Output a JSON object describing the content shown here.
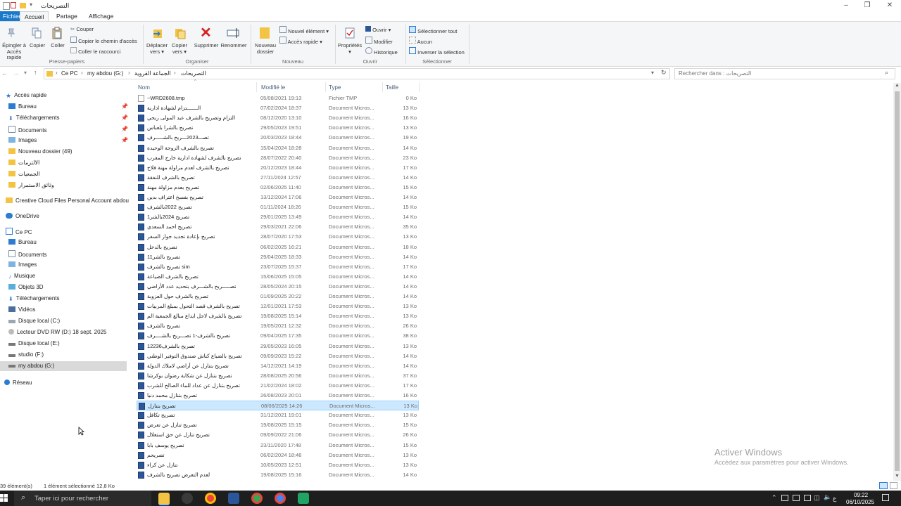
{
  "window": {
    "title": "التصريحات",
    "controls": [
      "–",
      "❐",
      "✕"
    ]
  },
  "ribbon_tabs": [
    "Fichier",
    "Accueil",
    "Partage",
    "Affichage"
  ],
  "ribbon": {
    "pin_label_1": "Épingler à",
    "pin_label_2": "Accès rapide",
    "copy": "Copier",
    "paste": "Coller",
    "cut": "Couper",
    "copy_path": "Copier le chemin d'accès",
    "paste_shortcut": "Coller le raccourci",
    "group_clipboard": "Presse-papiers",
    "move_to_1": "Déplacer",
    "move_to_2": "vers ▾",
    "copy_to_1": "Copier",
    "copy_to_2": "vers ▾",
    "delete": "Supprimer",
    "rename": "Renommer",
    "group_organize": "Organiser",
    "new_folder_1": "Nouveau",
    "new_folder_2": "dossier",
    "new_item": "Nouvel élément ▾",
    "easy_access": "Accès rapide ▾",
    "group_new": "Nouveau",
    "properties": "Propriétés",
    "open": "Ouvrir ▾",
    "edit": "Modifier",
    "history": "Historique",
    "group_open": "Ouvrir",
    "select_all": "Sélectionner tout",
    "select_none": "Aucun",
    "invert_selection": "Inverser la sélection",
    "group_select": "Sélectionner"
  },
  "breadcrumb": [
    "Ce PC",
    "my abdou (G:)",
    "الجماعة القروية",
    "التصريحات"
  ],
  "search": {
    "placeholder": "Rechercher dans : التصريحات"
  },
  "nav_pane": {
    "quick_access": "Accès rapide",
    "quick_items": [
      "Bureau",
      "Téléchargements",
      "Documents",
      "Images",
      "Nouveau dossier (49)",
      "الالتزمات",
      "الجمعيات",
      "وثائق الاستمرار"
    ],
    "creative_cloud": "Creative Cloud Files Personal Account abdou",
    "onedrive": "OneDrive",
    "this_pc": "Ce PC",
    "pc_items": [
      "Bureau",
      "Documents",
      "Images",
      "Musique",
      "Objets 3D",
      "Téléchargements",
      "Vidéos",
      "Disque local (C:)",
      "Lecteur DVD RW (D:) 18 sept. 2025",
      "Disque local (E:)",
      "studio (F:)",
      "my abdou (G:)"
    ],
    "network": "Réseau"
  },
  "columns": [
    "Nom",
    "Modifié le",
    "Type",
    "Taille"
  ],
  "files": [
    {
      "name": "~WRD2608.tmp",
      "date": "05/08/2021 19:13",
      "type": "Fichier TMP",
      "size": "0 Ko"
    },
    {
      "name": "الـــــــتزام لشهادة ادارية",
      "date": "07/02/2024 18:37",
      "type": "Document Micros...",
      "size": "13 Ko"
    },
    {
      "name": "التزام وتصريح بالشرف عبد المولى ربحي",
      "date": "08/12/2020 13:10",
      "type": "Document Micros...",
      "size": "16 Ko"
    },
    {
      "name": "تصريح بالشرا بلعباس",
      "date": "29/05/2023 19:51",
      "type": "Document Micros...",
      "size": "13 Ko"
    },
    {
      "name": "تصـــ2023ـــريح بالشـــــرف",
      "date": "20/03/2023 18:44",
      "type": "Document Micros...",
      "size": "19 Ko"
    },
    {
      "name": "تصريح بالشرف الزوجة الوحيدة",
      "date": "15/04/2024 18:28",
      "type": "Document Micros...",
      "size": "14 Ko"
    },
    {
      "name": "تصريح بالشرف لشهادة ادارية خارج المغرب",
      "date": "28/07/2022 20:40",
      "type": "Document Micros...",
      "size": "23 Ko"
    },
    {
      "name": "تصريح بالشرف لعدم مزاولة مهنة فلاح",
      "date": "20/12/2023 18:44",
      "type": "Document Micros...",
      "size": "17 Ko"
    },
    {
      "name": "تصريح بالشرف للنفقة",
      "date": "27/11/2024 12:57",
      "type": "Document Micros...",
      "size": "14 Ko"
    },
    {
      "name": "تصريح بعدم مزاولة مهنة",
      "date": "02/06/2025 11:40",
      "type": "Document Micros...",
      "size": "15 Ko"
    },
    {
      "name": "تصريح بفسخ اعتراف بدين",
      "date": "13/12/2024 17:06",
      "type": "Document Micros...",
      "size": "14 Ko"
    },
    {
      "name": "تصريح 2022بالشرف",
      "date": "01/11/2024 18:26",
      "type": "Document Micros...",
      "size": "15 Ko"
    },
    {
      "name": "تصريح 2024بالشر1",
      "date": "29/01/2025 13:49",
      "type": "Document Micros...",
      "size": "14 Ko"
    },
    {
      "name": "تصريح احمد السعدي",
      "date": "29/03/2021 22:06",
      "type": "Document Micros...",
      "size": "35 Ko"
    },
    {
      "name": "تصريح بإعادة تجديد جواز السفر",
      "date": "28/07/2020 17:53",
      "type": "Document Micros...",
      "size": "13 Ko"
    },
    {
      "name": "تصريح بالدخل",
      "date": "06/02/2025 16:21",
      "type": "Document Micros...",
      "size": "18 Ko"
    },
    {
      "name": "تصريح بالشر11",
      "date": "29/04/2025 18:33",
      "type": "Document Micros...",
      "size": "14 Ko"
    },
    {
      "name": "تصريح بالشرف sim",
      "date": "23/07/2025 15:37",
      "type": "Document Micros...",
      "size": "17 Ko"
    },
    {
      "name": "تصريح بالشرف الضياعة",
      "date": "15/06/2025 15:05",
      "type": "Document Micros...",
      "size": "14 Ko"
    },
    {
      "name": "تصـــــريح بالشـــرف بتحديد عدد الأراضي",
      "date": "28/05/2024 20:15",
      "type": "Document Micros...",
      "size": "14 Ko"
    },
    {
      "name": "تصريح بالشرف حول العزوبة",
      "date": "01/09/2025 20:22",
      "type": "Document Micros...",
      "size": "14 Ko"
    },
    {
      "name": "تصريح بالشرف قصد التحول بمبلغ المربيات",
      "date": "12/01/2021 17:53",
      "type": "Document Micros...",
      "size": "13 Ko"
    },
    {
      "name": "تصريح بالشرف لاجل ايداع مبالغ الجمعية الم",
      "date": "19/08/2025 15:14",
      "type": "Document Micros...",
      "size": "13 Ko"
    },
    {
      "name": "تصريح بالشرف",
      "date": "19/05/2021 12:32",
      "type": "Document Micros...",
      "size": "26 Ko"
    },
    {
      "name": "تصريح بالشرف-1 تصـــريح بالشــــرف",
      "date": "09/04/2025 17:35",
      "type": "Document Micros...",
      "size": "38 Ko"
    },
    {
      "name": "تصريح بالشرف12236",
      "date": "29/05/2023 16:05",
      "type": "Document Micros...",
      "size": "13 Ko"
    },
    {
      "name": "تصريح بالضياع كناش صندوق التوفير الوطني",
      "date": "09/09/2023 15:22",
      "type": "Document Micros...",
      "size": "14 Ko"
    },
    {
      "name": "تصريح بتنازل عن أراضي لاملاك الدولة",
      "date": "14/12/2021 14:19",
      "type": "Document Micros...",
      "size": "14 Ko"
    },
    {
      "name": "تصريح بتنازل عن شكاية رضوان بوكرشا",
      "date": "28/08/2025 20:56",
      "type": "Document Micros...",
      "size": "37 Ko"
    },
    {
      "name": "تصريح بتنازل عن عداد للماء الصالح للشرب",
      "date": "21/02/2024 18:02",
      "type": "Document Micros...",
      "size": "17 Ko"
    },
    {
      "name": "تصريح بتنازل محمد دنيا",
      "date": "26/08/2023 20:01",
      "type": "Document Micros...",
      "size": "16 Ko"
    },
    {
      "name": "تصريح بتنازل",
      "date": "08/06/2025 14:26",
      "type": "Document Micros...",
      "size": "13 Ko"
    },
    {
      "name": "تصريح تكافل",
      "date": "31/12/2021 19:01",
      "type": "Document Micros...",
      "size": "13 Ko"
    },
    {
      "name": "تصريح تنازل عن تعرض",
      "date": "19/08/2025 15:15",
      "type": "Document Micros...",
      "size": "15 Ko"
    },
    {
      "name": "تصريح تنازل عن حق استغلال",
      "date": "09/09/2022 21:06",
      "type": "Document Micros...",
      "size": "26 Ko"
    },
    {
      "name": "تصريح يوسف بابا",
      "date": "23/11/2020 17:48",
      "type": "Document Micros...",
      "size": "15 Ko"
    },
    {
      "name": "تصريحم",
      "date": "06/02/2024 18:46",
      "type": "Document Micros...",
      "size": "13 Ko"
    },
    {
      "name": "تنازل عن كراء",
      "date": "10/05/2023 12:51",
      "type": "Document Micros...",
      "size": "13 Ko"
    },
    {
      "name": "لعدم التعرض تصريح بالشرف",
      "date": "19/08/2025 15:16",
      "type": "Document Micros...",
      "size": "14 Ko"
    }
  ],
  "selected_index": 31,
  "status": {
    "count": "39 élément(s)",
    "selection": "1 élément sélectionné  12,8 Ko"
  },
  "watermark": {
    "line1": "Activer Windows",
    "line2": "Accédez aux paramètres pour activer Windows."
  },
  "taskbar": {
    "search_placeholder": "Taper ici pour rechercher",
    "time": "09:22",
    "date": "06/10/2025",
    "lang": "ع"
  },
  "colors": {
    "accent": "#1979ca",
    "selection": "#cce8ff",
    "word_blue": "#2b579a",
    "folder": "#f3c443",
    "taskbar": "#1e1e1e"
  }
}
